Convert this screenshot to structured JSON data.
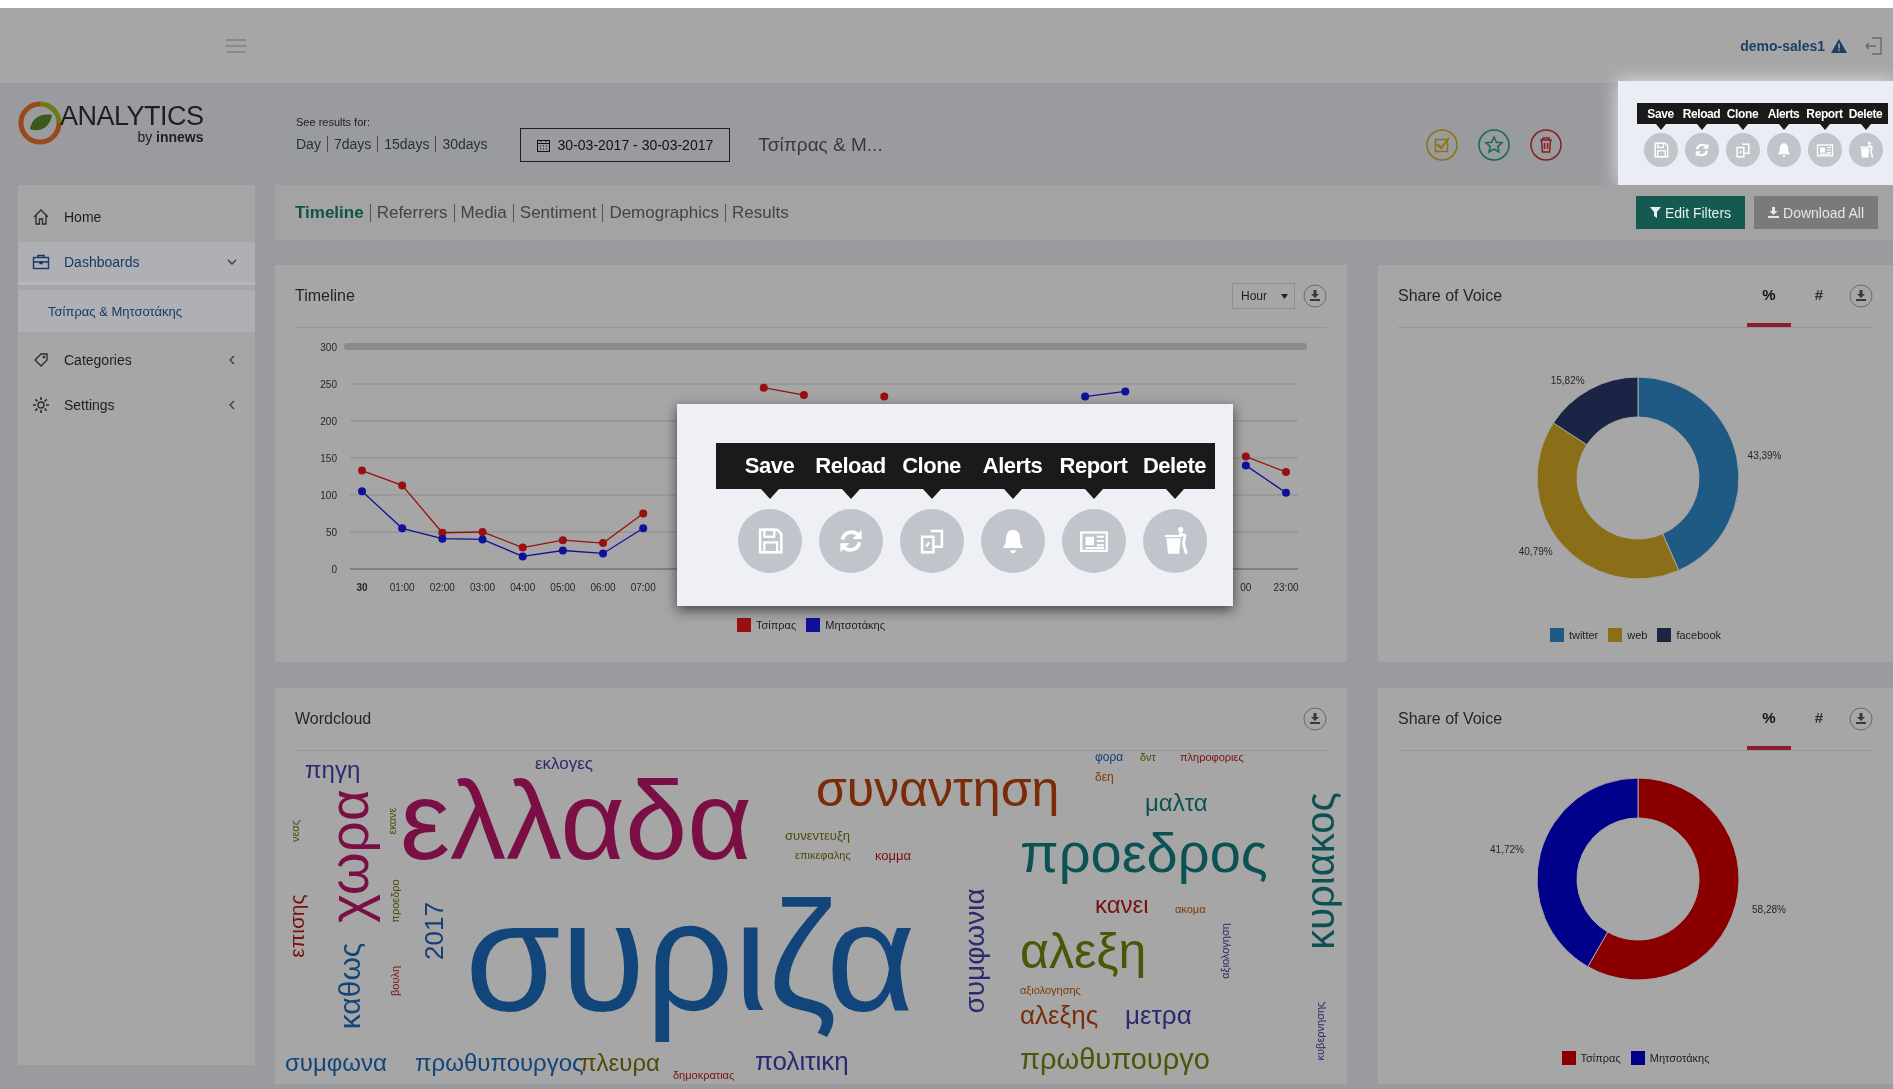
{
  "top_bar": {
    "user": "demo-sales1"
  },
  "logo": {
    "name": "ANALYTICS",
    "byline": "by **innews**"
  },
  "period": {
    "label": "See results for:",
    "options": [
      {
        "label": "Day"
      },
      {
        "label": "7days"
      },
      {
        "label": "15days"
      },
      {
        "label": "30days"
      }
    ]
  },
  "date_range": "30-03-2017 - 30-03-2017",
  "dashboard_title": "Τσίπρας & Μ...",
  "toolbar": [
    {
      "label": "Save",
      "kind": "save"
    },
    {
      "label": "Reload",
      "kind": "reload"
    },
    {
      "label": "Clone",
      "kind": "clone"
    },
    {
      "label": "Alerts",
      "kind": "alerts"
    },
    {
      "label": "Report",
      "kind": "report"
    },
    {
      "label": "Delete",
      "kind": "delete"
    }
  ],
  "sidebar": {
    "items": [
      {
        "label": "Home",
        "kind": "home",
        "selected": false
      },
      {
        "label": "Dashboards",
        "kind": "dashboard",
        "selected": true,
        "expanded": true,
        "children": [
          {
            "label": "Τσίπρας & Μητσοτάκης",
            "selected": true
          }
        ]
      },
      {
        "label": "Categories",
        "kind": "tag",
        "selected": false,
        "expanded": false
      },
      {
        "label": "Settings",
        "kind": "gear",
        "selected": false,
        "expanded": false
      }
    ]
  },
  "tabs": [
    {
      "label": "Timeline",
      "selected": true
    },
    {
      "label": "Referrers",
      "selected": false
    },
    {
      "label": "Media",
      "selected": false
    },
    {
      "label": "Sentiment",
      "selected": false
    },
    {
      "label": "Demographics",
      "selected": false
    },
    {
      "label": "Results",
      "selected": false
    }
  ],
  "filter_buttons": [
    {
      "label": "Edit Filters",
      "kind": "filter",
      "disabled": false
    },
    {
      "label": "Download All",
      "kind": "download",
      "disabled": true
    }
  ],
  "timeline": {
    "title": "Timeline",
    "interval": "Hour",
    "chart_data": {
      "type": "line",
      "legend": "bottom",
      "grid": true,
      "categories": [
        "30",
        "01:00",
        "02:00",
        "03:00",
        "04:00",
        "05:00",
        "06:00",
        "07:00",
        null,
        null,
        null,
        null,
        null,
        null,
        null,
        null,
        null,
        null,
        null,
        null,
        null,
        null,
        "00",
        "23:00"
      ],
      "ylim": [
        0,
        300
      ],
      "yticks": [
        0,
        50,
        100,
        150,
        200,
        250,
        300
      ],
      "series": [
        {
          "name": "Τσίπρας",
          "color": "#9a1010",
          "marker": true,
          "values": [
            133,
            113,
            49,
            50,
            29,
            39,
            35,
            75,
            null,
            null,
            245,
            235,
            null,
            233,
            null,
            null,
            null,
            null,
            null,
            null,
            null,
            null,
            152,
            131
          ]
        },
        {
          "name": "Μητσοτάκης",
          "color": "#10109a",
          "marker": true,
          "values": [
            105,
            55,
            41,
            40,
            17,
            25,
            21,
            55,
            null,
            null,
            null,
            null,
            null,
            null,
            null,
            null,
            null,
            null,
            233,
            240,
            null,
            null,
            140,
            103
          ]
        }
      ]
    }
  },
  "share_of_voice_sources": {
    "title": "Share of Voice",
    "modes": [
      {
        "label": "%",
        "selected": true
      },
      {
        "label": "#",
        "selected": false
      }
    ],
    "chart_data": {
      "type": "donut",
      "legend": "bottom",
      "categories": [
        "twitter",
        "web",
        "facebook"
      ],
      "values": [
        43.39,
        40.79,
        15.82
      ],
      "colors": [
        "#1f5a85",
        "#8a6e18",
        "#1a2545"
      ],
      "value_labels": [
        "43,39%",
        "40,79%",
        "15,82%"
      ]
    }
  },
  "wordcloud": {
    "title": "Wordcloud",
    "words": [
      {
        "text": "πηγη",
        "color": "#2a2a70"
      },
      {
        "text": "εκλογες",
        "color": "#2a2a70"
      },
      {
        "text": "συνεντευξη",
        "color": "#4f4a08"
      },
      {
        "text": "ελλαδα",
        "color": "#7a0f45"
      },
      {
        "text": "συναντηση",
        "color": "#7a2c08"
      },
      {
        "text": "προεδρος",
        "color": "#0c5252"
      },
      {
        "text": "μαλτα",
        "color": "#0c5252"
      },
      {
        "text": "φορα",
        "color": "#153f75"
      },
      {
        "text": "δντ",
        "color": "#4f4a08"
      },
      {
        "text": "πληροφοριες",
        "color": "#7a1010"
      },
      {
        "text": "δεη",
        "color": "#7a3a08"
      },
      {
        "text": "κυριακος",
        "color": "#0c5252"
      },
      {
        "text": "χωρα",
        "color": "#7a0f45"
      },
      {
        "text": "εκανε",
        "color": "#4f4a08"
      },
      {
        "text": "νεας",
        "color": "#4f4a08"
      },
      {
        "text": "επικεφαλης",
        "color": "#4f4a08"
      },
      {
        "text": "επισης",
        "color": "#7a1010"
      },
      {
        "text": "προεδρο",
        "color": "#4f4a08"
      },
      {
        "text": "2017",
        "color": "#153f75"
      },
      {
        "text": "κομμα",
        "color": "#7a1010"
      },
      {
        "text": "συριζα",
        "color": "#12457a"
      },
      {
        "text": "καθως",
        "color": "#12457a"
      },
      {
        "text": "συμφωνια",
        "color": "#2a2a70"
      },
      {
        "text": "βουλη",
        "color": "#7a1010"
      },
      {
        "text": "κανει",
        "color": "#7a1010"
      },
      {
        "text": "ακομα",
        "color": "#7a3a08"
      },
      {
        "text": "αλεξη",
        "color": "#4a5608"
      },
      {
        "text": "αξιολογησης",
        "color": "#7a3a08"
      },
      {
        "text": "αξιολογηση",
        "color": "#2a2a70"
      },
      {
        "text": "κυβερνησης",
        "color": "#2a2a70"
      },
      {
        "text": "αλεξης",
        "color": "#7a2c08"
      },
      {
        "text": "μετρα",
        "color": "#2a2a70"
      },
      {
        "text": "συμφωνα",
        "color": "#12457a"
      },
      {
        "text": "πρωθυπουργος",
        "color": "#12457a"
      },
      {
        "text": "πλευρα",
        "color": "#4f4a08"
      },
      {
        "text": "δημοκρατιας",
        "color": "#7a1010"
      },
      {
        "text": "πολιτικη",
        "color": "#2a2a70"
      },
      {
        "text": "πρωθυπουργο",
        "color": "#4a5608"
      }
    ]
  },
  "share_of_voice_people": {
    "title": "Share of Voice",
    "modes": [
      {
        "label": "%",
        "selected": true
      },
      {
        "label": "#",
        "selected": false
      }
    ],
    "chart_data": {
      "type": "donut",
      "legend": "bottom",
      "categories": [
        "Τσίπρας",
        "Μητσοτάκης"
      ],
      "values": [
        58.28,
        41.72
      ],
      "colors": [
        "#8a0000",
        "#00008a"
      ],
      "value_labels": [
        "58,28%",
        "41,72%"
      ]
    }
  },
  "tour_popup": {
    "items": [
      {
        "label": "Save",
        "kind": "save"
      },
      {
        "label": "Reload",
        "kind": "reload"
      },
      {
        "label": "Clone",
        "kind": "clone"
      },
      {
        "label": "Alerts",
        "kind": "alerts"
      },
      {
        "label": "Report",
        "kind": "report"
      },
      {
        "label": "Delete",
        "kind": "delete"
      }
    ]
  }
}
